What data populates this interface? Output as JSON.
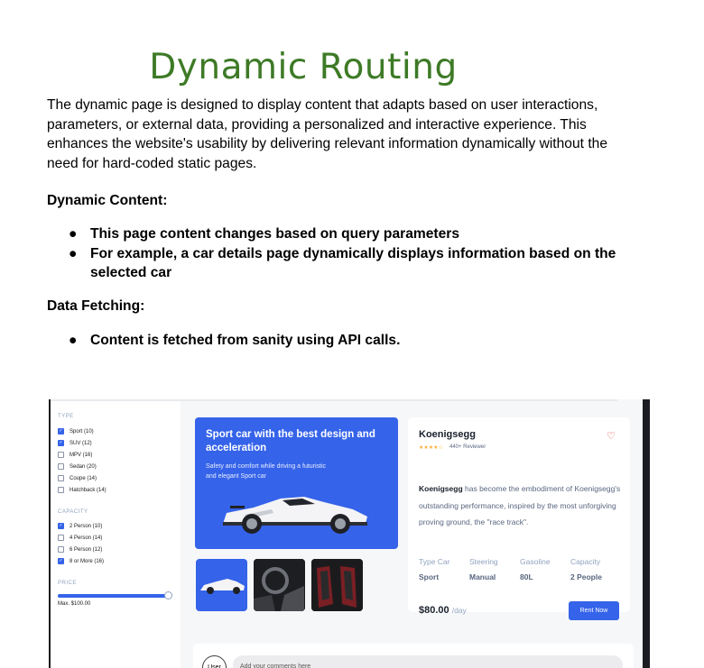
{
  "doc": {
    "title": "Dynamic Routing",
    "intro": "The dynamic page is designed to display content that adapts based on user interactions, parameters, or external data, providing a personalized and interactive experience. This enhances the website's usability by delivering relevant information dynamically without the need for hard-coded static pages.",
    "dynamic_content": {
      "heading": "Dynamic Content:",
      "bullets": [
        "This page content changes based on query parameters",
        "For example, a car details page dynamically displays information based on the selected car"
      ]
    },
    "data_fetching": {
      "heading": "Data Fetching:",
      "bullets": [
        "Content is fetched from sanity using API calls."
      ]
    }
  },
  "screenshot": {
    "sidebar": {
      "type_heading": "TYPE",
      "types": [
        {
          "label": "Sport (10)",
          "checked": true
        },
        {
          "label": "SUV (12)",
          "checked": true
        },
        {
          "label": "MPV (16)",
          "checked": false
        },
        {
          "label": "Sedan (20)",
          "checked": false
        },
        {
          "label": "Coupe (14)",
          "checked": false
        },
        {
          "label": "Hatchback (14)",
          "checked": false
        }
      ],
      "capacity_heading": "CAPACITY",
      "capacities": [
        {
          "label": "2 Person (10)",
          "checked": true
        },
        {
          "label": "4 Person (14)",
          "checked": false
        },
        {
          "label": "6 Person (12)",
          "checked": false
        },
        {
          "label": "8 or More (16)",
          "checked": true
        }
      ],
      "price_heading": "PRICE",
      "price_max": "Max. $100.00",
      "price_level": 1.0
    },
    "promo": {
      "title": "Sport car with the best design and acceleration",
      "subtitle": "Safety and comfort while driving a futuristic and elegant Sport car"
    },
    "detail": {
      "name": "Koenigsegg",
      "stars": "★★★★☆",
      "reviews": "440+ Reviewer",
      "desc_brand": "Koenigsegg",
      "desc_rest": " has become the embodiment of Koenigsegg's outstanding performance, inspired by the most unforgiving proving ground, the \"race track\".",
      "specs": [
        {
          "label": "Type Car",
          "value": "Sport"
        },
        {
          "label": "Steering",
          "value": "Manual"
        },
        {
          "label": "Gasoline",
          "value": "80L"
        },
        {
          "label": "Capacity",
          "value": "2 People"
        }
      ],
      "price": "$80.00",
      "price_unit": "/day",
      "rent_label": "Rent Now"
    },
    "comment": {
      "avatar_label": "User",
      "placeholder": "Add your comments here"
    },
    "colors": {
      "accent": "#3563e9",
      "title_green": "#3d7a26",
      "heart": "#ed3f3f"
    }
  }
}
